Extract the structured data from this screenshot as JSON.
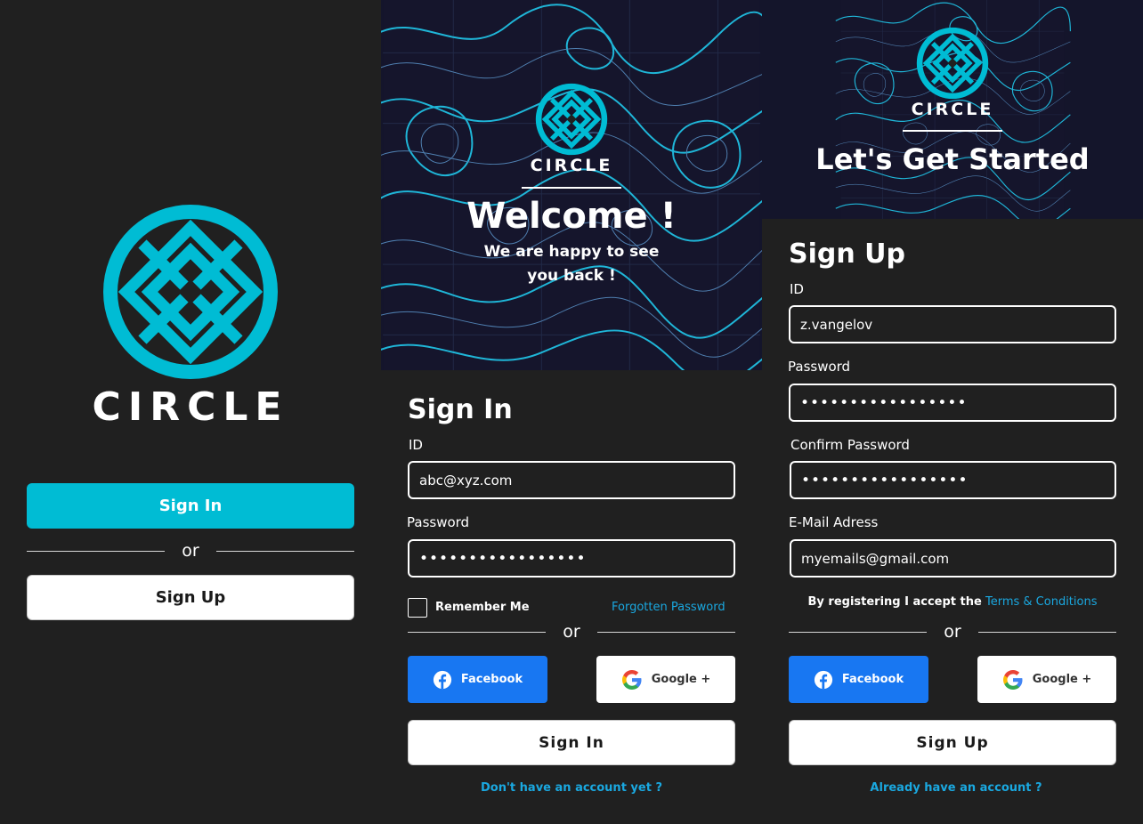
{
  "brand": {
    "name": "CIRCLE",
    "accent": "#00bcd4"
  },
  "splash": {
    "signin_label": "Sign In",
    "or_label": "or",
    "signup_label": "Sign Up"
  },
  "signin": {
    "hero_title": "Welcome !",
    "hero_subtitle_line1": "We are happy to see",
    "hero_subtitle_line2": "you back !",
    "form_title": "Sign In",
    "id_label": "ID",
    "id_value": "abc@xyz.com",
    "password_label": "Password",
    "password_value": "•••••••••••••••••",
    "remember_label": "Remember Me",
    "forgot_label": "Forgotten Password",
    "or_label": "or",
    "facebook_label": "Facebook",
    "google_label": "Google +",
    "submit_label": "Sign In",
    "bottom_link": "Don't have an account yet ?"
  },
  "signup": {
    "hero_title": "Let's Get Started",
    "form_title": "Sign Up",
    "id_label": "ID",
    "id_value": "z.vangelov",
    "password_label": "Password",
    "password_value": "•••••••••••••••••",
    "confirm_label": "Confirm Password",
    "confirm_value": "•••••••••••••••••",
    "email_label": "E-Mail Adress",
    "email_value": "myemails@gmail.com",
    "terms_prefix": "By registering I accept the",
    "terms_link": "Terms & Conditions",
    "or_label": "or",
    "facebook_label": "Facebook",
    "google_label": "Google +",
    "submit_label": "Sign Up",
    "bottom_link": "Already  have an account ?"
  }
}
